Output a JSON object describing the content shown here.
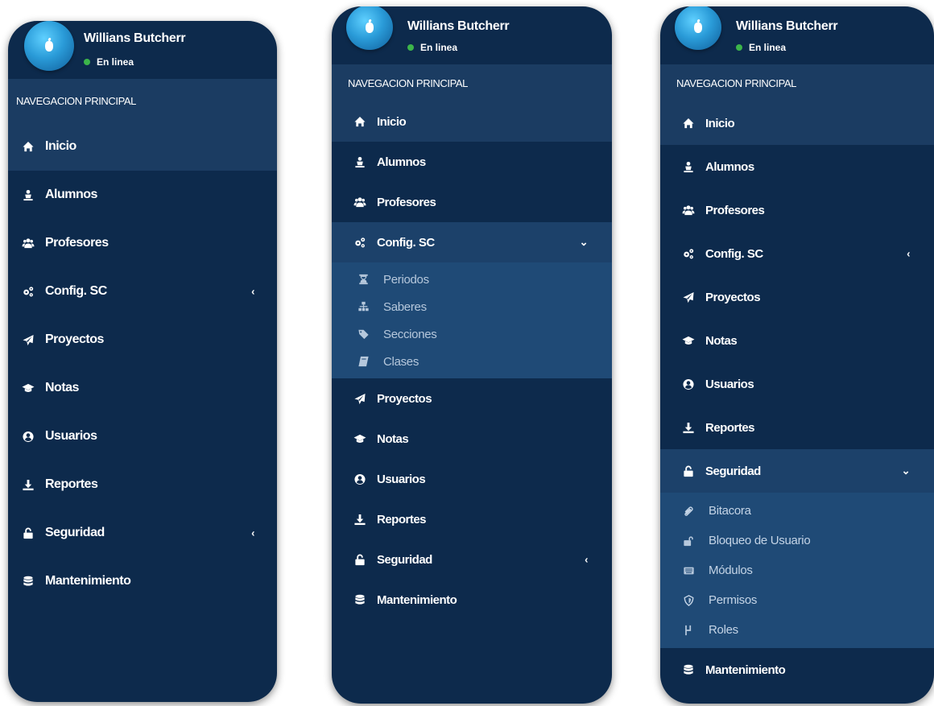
{
  "user": {
    "name": "Willians Butcherr",
    "status": "En linea",
    "status_color": "#3cb54a"
  },
  "nav_header": "NAVEGACION PRINCIPAL",
  "colors": {
    "sidebar_bg": "#0d2a4c",
    "active_bg": "#1b3c62",
    "submenu_bg": "#1f4a76"
  },
  "panel_1": {
    "items": [
      {
        "label": "Inicio",
        "icon": "home-icon",
        "active": true
      },
      {
        "label": "Alumnos",
        "icon": "student-icon"
      },
      {
        "label": "Profesores",
        "icon": "users-icon"
      },
      {
        "label": "Config. SC",
        "icon": "cogs-icon",
        "chevron": "‹"
      },
      {
        "label": "Proyectos",
        "icon": "paper-plane-icon"
      },
      {
        "label": "Notas",
        "icon": "graduation-cap-icon"
      },
      {
        "label": "Usuarios",
        "icon": "user-circle-icon"
      },
      {
        "label": "Reportes",
        "icon": "download-icon"
      },
      {
        "label": "Seguridad",
        "icon": "unlock-icon",
        "chevron": "‹"
      },
      {
        "label": "Mantenimiento",
        "icon": "database-icon"
      }
    ]
  },
  "panel_2": {
    "items": [
      {
        "label": "Inicio",
        "icon": "home-icon",
        "active": true
      },
      {
        "label": "Alumnos",
        "icon": "student-icon"
      },
      {
        "label": "Profesores",
        "icon": "users-icon"
      },
      {
        "label": "Config. SC",
        "icon": "cogs-icon",
        "chevron": "⌄",
        "open": true,
        "subitems": [
          {
            "label": "Periodos",
            "icon": "hourglass-icon"
          },
          {
            "label": "Saberes",
            "icon": "sitemap-icon"
          },
          {
            "label": "Secciones",
            "icon": "tags-icon"
          },
          {
            "label": "Clases",
            "icon": "book-icon"
          }
        ]
      },
      {
        "label": "Proyectos",
        "icon": "paper-plane-icon"
      },
      {
        "label": "Notas",
        "icon": "graduation-cap-icon"
      },
      {
        "label": "Usuarios",
        "icon": "user-circle-icon"
      },
      {
        "label": "Reportes",
        "icon": "download-icon"
      },
      {
        "label": "Seguridad",
        "icon": "unlock-icon",
        "chevron": "‹"
      },
      {
        "label": "Mantenimiento",
        "icon": "database-icon"
      }
    ]
  },
  "panel_3": {
    "items": [
      {
        "label": "Inicio",
        "icon": "home-icon",
        "active": true
      },
      {
        "label": "Alumnos",
        "icon": "student-icon"
      },
      {
        "label": "Profesores",
        "icon": "users-icon"
      },
      {
        "label": "Config. SC",
        "icon": "cogs-icon",
        "chevron": "‹"
      },
      {
        "label": "Proyectos",
        "icon": "paper-plane-icon"
      },
      {
        "label": "Notas",
        "icon": "graduation-cap-icon"
      },
      {
        "label": "Usuarios",
        "icon": "user-circle-icon"
      },
      {
        "label": "Reportes",
        "icon": "download-icon"
      },
      {
        "label": "Seguridad",
        "icon": "unlock-icon",
        "chevron": "⌄",
        "open": true,
        "subitems": [
          {
            "label": "Bitacora",
            "icon": "paperclip-icon"
          },
          {
            "label": "Bloqueo de Usuario",
            "icon": "unlock-alt-icon"
          },
          {
            "label": "Módulos",
            "icon": "keyboard-icon"
          },
          {
            "label": "Permisos",
            "icon": "shield-icon"
          },
          {
            "label": "Roles",
            "icon": "roles-icon"
          }
        ]
      },
      {
        "label": "Mantenimiento",
        "icon": "database-icon"
      }
    ]
  }
}
